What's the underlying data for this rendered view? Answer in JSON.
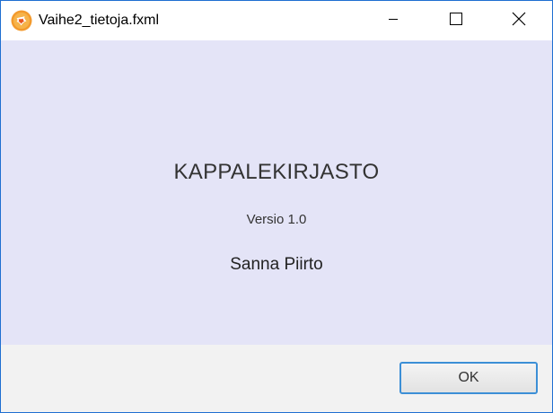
{
  "window": {
    "title": "Vaihe2_tietoja.fxml",
    "icon": "app-logo-icon",
    "controls": {
      "minimize_icon": "minimize-icon",
      "maximize_icon": "maximize-icon",
      "close_icon": "close-icon"
    }
  },
  "about": {
    "heading": "KAPPALEKIRJASTO",
    "version": "Versio 1.0",
    "author": "Sanna Piirto"
  },
  "footer": {
    "ok_label": "OK"
  },
  "colors": {
    "content_background": "#e4e4f7",
    "footer_background": "#f2f2f2",
    "window_border": "#1f6fd1",
    "button_focus_border": "#3c8fd6",
    "icon_orange": "#f7941d"
  }
}
